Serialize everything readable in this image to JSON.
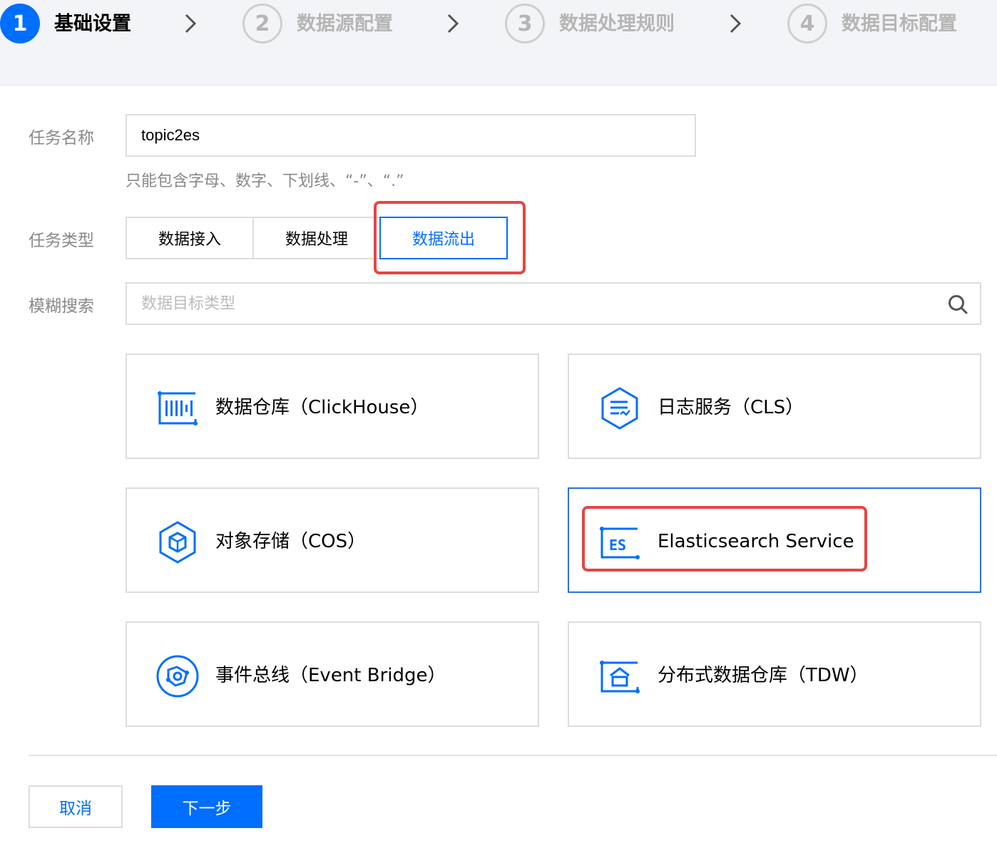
{
  "steps": [
    {
      "number": "1",
      "label": "基础设置",
      "state": "active"
    },
    {
      "number": "2",
      "label": "数据源配置",
      "state": "inactive"
    },
    {
      "number": "3",
      "label": "数据处理规则",
      "state": "inactive"
    },
    {
      "number": "4",
      "label": "数据目标配置",
      "state": "inactive"
    }
  ],
  "form": {
    "task_name_label": "任务名称",
    "task_name_value": "topic2es",
    "task_name_hint": "只能包含字母、数字、下划线、“-”、“.”",
    "task_type_label": "任务类型",
    "task_types": [
      "数据接入",
      "数据处理",
      "数据流出"
    ],
    "task_type_selected": "数据流出",
    "search_label": "模糊搜索",
    "search_placeholder": "数据目标类型"
  },
  "targets": [
    {
      "label": "数据仓库（ClickHouse）",
      "icon": "clickhouse-icon"
    },
    {
      "label": "日志服务（CLS）",
      "icon": "cls-icon"
    },
    {
      "label": "对象存储（COS）",
      "icon": "cos-icon"
    },
    {
      "label": "Elasticsearch Service",
      "icon": "es-icon",
      "selected": true
    },
    {
      "label": "事件总线（Event Bridge）",
      "icon": "event-bridge-icon"
    },
    {
      "label": "分布式数据仓库（TDW）",
      "icon": "tdw-icon"
    }
  ],
  "buttons": {
    "cancel": "取消",
    "next": "下一步"
  },
  "colors": {
    "primary": "#006eff",
    "highlight": "#e54545",
    "border": "#dddddd",
    "muted": "#888888"
  }
}
